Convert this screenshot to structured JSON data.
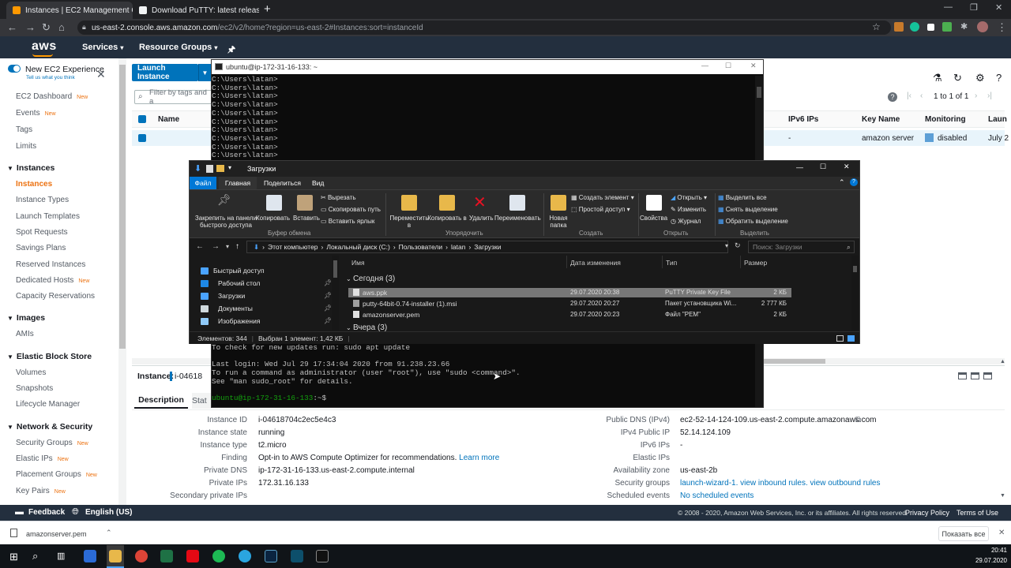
{
  "browser": {
    "tabs": [
      {
        "title": "Instances | EC2 Management Co",
        "active": true
      },
      {
        "title": "Download PuTTY: latest release (",
        "active": false
      }
    ],
    "url_host": "us-east-2.console.aws.amazon.com",
    "url_path": "/ec2/v2/home?region=us-east-2#Instances:sort=instanceId"
  },
  "aws": {
    "logo": "aws",
    "services_label": "Services",
    "resource_groups_label": "Resource Groups",
    "footer": {
      "feedback": "Feedback",
      "language": "English (US)",
      "copyright": "© 2008 - 2020, Amazon Web Services, Inc. or its affiliates. All rights reserved.",
      "privacy": "Privacy Policy",
      "terms": "Terms of Use"
    }
  },
  "sidebar": {
    "new_experience": "New EC2 Experience",
    "tell_us": "Tell us what you think",
    "new_badge": "New",
    "top_items": [
      {
        "label": "EC2 Dashboard",
        "new": true
      },
      {
        "label": "Events",
        "new": true
      },
      {
        "label": "Tags",
        "new": false
      },
      {
        "label": "Limits",
        "new": false
      }
    ],
    "sections": [
      {
        "title": "Instances",
        "items": [
          {
            "label": "Instances",
            "selected": true,
            "new": false
          },
          {
            "label": "Instance Types",
            "new": false
          },
          {
            "label": "Launch Templates",
            "new": false
          },
          {
            "label": "Spot Requests",
            "new": false
          },
          {
            "label": "Savings Plans",
            "new": false
          },
          {
            "label": "Reserved Instances",
            "new": false
          },
          {
            "label": "Dedicated Hosts",
            "new": true
          },
          {
            "label": "Capacity Reservations",
            "new": false
          }
        ]
      },
      {
        "title": "Images",
        "items": [
          {
            "label": "AMIs",
            "new": false
          }
        ]
      },
      {
        "title": "Elastic Block Store",
        "items": [
          {
            "label": "Volumes",
            "new": false
          },
          {
            "label": "Snapshots",
            "new": false
          },
          {
            "label": "Lifecycle Manager",
            "new": false
          }
        ]
      },
      {
        "title": "Network & Security",
        "items": [
          {
            "label": "Security Groups",
            "new": true
          },
          {
            "label": "Elastic IPs",
            "new": true
          },
          {
            "label": "Placement Groups",
            "new": true
          },
          {
            "label": "Key Pairs",
            "new": true
          }
        ]
      }
    ]
  },
  "main": {
    "launch_button": "Launch Instance",
    "filter_placeholder": "Filter by tags and a",
    "pagination": "1 to 1 of 1",
    "columns": {
      "name": "Name",
      "ipv6": "IPv6 IPs",
      "key_name": "Key Name",
      "monitoring": "Monitoring",
      "launch": "Laun"
    },
    "row": {
      "ipv6": "-",
      "key_name": "amazon server",
      "monitoring": "disabled",
      "launch": "July 2"
    },
    "instance_label": "Instance:",
    "instance_id_partial": "i-04618",
    "tab_description": "Description",
    "tab_status_partial": "Stat",
    "details_left": [
      {
        "label": "Instance ID",
        "value": "i-04618704c2ec5e4c3"
      },
      {
        "label": "Instance state",
        "value": "running"
      },
      {
        "label": "Instance type",
        "value": "t2.micro"
      },
      {
        "label": "Finding",
        "value": "Opt-in to AWS Compute Optimizer for recommendations.",
        "link": "Learn more"
      },
      {
        "label": "Private DNS",
        "value": "ip-172-31-16-133.us-east-2.compute.internal"
      },
      {
        "label": "Private IPs",
        "value": "172.31.16.133"
      },
      {
        "label": "Secondary private IPs",
        "value": ""
      }
    ],
    "details_right": [
      {
        "label": "Public DNS (IPv4)",
        "value": "ec2-52-14-124-109.us-east-2.compute.amazonaws.com"
      },
      {
        "label": "IPv4 Public IP",
        "value": "52.14.124.109"
      },
      {
        "label": "IPv6 IPs",
        "value": "-"
      },
      {
        "label": "Elastic IPs",
        "value": ""
      },
      {
        "label": "Availability zone",
        "value": "us-east-2b"
      },
      {
        "label": "Security groups",
        "value": "launch-wizard-1. view inbound rules. view outbound rules",
        "link": true
      },
      {
        "label": "Scheduled events",
        "value": "No scheduled events",
        "link": true
      }
    ]
  },
  "terminal": {
    "title": "ubuntu@ip-172-31-16-133: ~",
    "prompt_lines": [
      "C:\\Users\\latan>",
      "C:\\Users\\latan>",
      "C:\\Users\\latan>",
      "C:\\Users\\latan>",
      "C:\\Users\\latan>",
      "C:\\Users\\latan>",
      "C:\\Users\\latan>",
      "C:\\Users\\latan>",
      "C:\\Users\\latan>",
      "C:\\Users\\latan>"
    ],
    "bottom_lines": [
      "To check for new updates run: sudo apt update",
      "",
      "Last login: Wed Jul 29 17:34:04 2020 from 91.238.23.66",
      "To run a command as administrator (user \"root\"), use \"sudo <command>\".",
      "See \"man sudo_root\" for details.",
      ""
    ],
    "shell_prompt_user": "ubuntu@ip-172-31-16-133",
    "shell_prompt_rest": ":~$"
  },
  "explorer": {
    "title": "Загрузки",
    "ribbon_tabs": [
      "Файл",
      "Главная",
      "Поделиться",
      "Вид"
    ],
    "clipboard": {
      "pin": "Закрепить на панели быстрого доступа",
      "copy": "Копировать",
      "paste": "Вставить",
      "cut": "Вырезать",
      "copy_path": "Скопировать путь",
      "paste_shortcut": "Вставить ярлык",
      "group": "Буфер обмена"
    },
    "organize": {
      "move": "Переместить в",
      "copy": "Копировать в",
      "delete": "Удалить",
      "rename": "Переименовать",
      "group": "Упорядочить"
    },
    "create": {
      "new_folder": "Новая папка",
      "new_item": "Создать элемент",
      "easy_access": "Простой доступ",
      "group": "Создать"
    },
    "open": {
      "properties": "Свойства",
      "open": "Открыть",
      "edit": "Изменить",
      "history": "Журнал",
      "group": "Открыть"
    },
    "select": {
      "all": "Выделить все",
      "none": "Снять выделение",
      "invert": "Обратить выделение",
      "group": "Выделить"
    },
    "path": [
      "Этот компьютер",
      "Локальный диск (C:)",
      "Пользователи",
      "latan",
      "Загрузки"
    ],
    "search_placeholder": "Поиск: Загрузки",
    "nav": [
      {
        "label": "Быстрый доступ",
        "icon": "star"
      },
      {
        "label": "Рабочий стол",
        "icon": "desktop"
      },
      {
        "label": "Загрузки",
        "icon": "download"
      },
      {
        "label": "Документы",
        "icon": "documents"
      },
      {
        "label": "Изображения",
        "icon": "images"
      }
    ],
    "columns": {
      "name": "Имя",
      "date": "Дата изменения",
      "type": "Тип",
      "size": "Размер"
    },
    "group_today": "Сегодня (3)",
    "group_yesterday": "Вчера (3)",
    "files": [
      {
        "name": "aws.ppk",
        "date": "29.07.2020 20:38",
        "type": "PuTTY Private Key File",
        "size": "2 КБ",
        "selected": true
      },
      {
        "name": "putty-64bit-0.74-installer (1).msi",
        "date": "29.07.2020 20:27",
        "type": "Пакет установщика Wi...",
        "size": "2 777 КБ",
        "selected": false
      },
      {
        "name": "amazonserver.pem",
        "date": "29.07.2020 20:23",
        "type": "Файл \"PEM\"",
        "size": "2 КБ",
        "selected": false
      }
    ],
    "status_count": "Элементов: 344",
    "status_selected": "Выбран 1 элемент: 1,42 КБ"
  },
  "download_bar": {
    "file": "amazonserver.pem",
    "show_all": "Показать все"
  },
  "taskbar": {
    "time": "20:41",
    "date": "29.07.2020"
  },
  "colors": {
    "aws_orange": "#ec7211",
    "aws_blue": "#0073bb",
    "aws_nav": "#232f3e",
    "win_blue": "#0078d7"
  }
}
